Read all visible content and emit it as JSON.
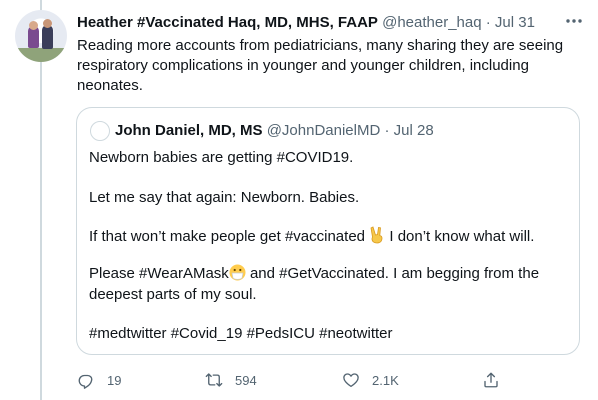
{
  "tweet": {
    "author_name": "Heather #Vaccinated Haq, MD, MHS, FAAP",
    "handle": "@heather_haq",
    "separator": "·",
    "date": "Jul 31",
    "text": "Reading more accounts from pediatricians, many sharing they are seeing respiratory complications in younger and younger children, including neonates."
  },
  "quoted": {
    "author_name": "John Daniel, MD, MS",
    "handle": "@JohnDanielMD",
    "separator": "·",
    "date": "Jul 28",
    "line1": "Newborn babies are getting #COVID19.",
    "line2": "Let me say that again: Newborn. Babies.",
    "line3a": "If that won’t make people get #vaccinated",
    "line3b": "I don’t know what will.",
    "line4a": "Please #WearAMask",
    "line4b": "and #GetVaccinated. I am begging from the",
    "line5": "deepest parts of my soul.",
    "line6": "#medtwitter #Covid_19 #PedsICU #neotwitter"
  },
  "actions": {
    "replies": "19",
    "retweets": "594",
    "likes": "2.1K"
  },
  "icons": {
    "more": "more-horizontal-icon",
    "reply": "reply-icon",
    "retweet": "retweet-icon",
    "like": "heart-icon",
    "share": "share-icon"
  },
  "colors": {
    "text": "#0f1419",
    "secondary": "#536471",
    "border": "#cfd9de"
  }
}
